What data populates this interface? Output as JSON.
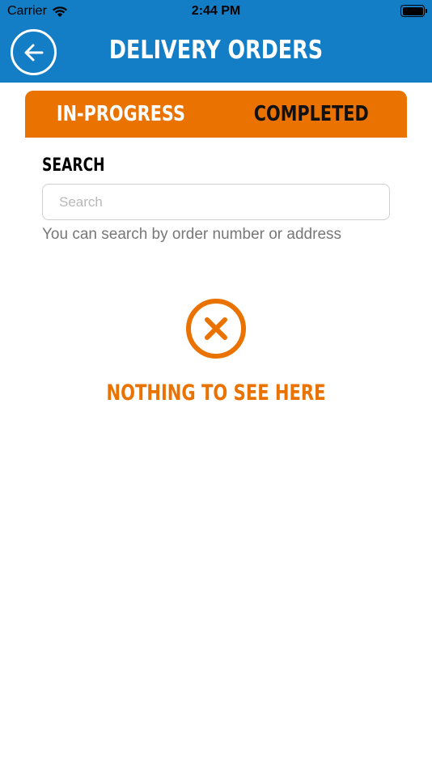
{
  "status_bar": {
    "carrier": "Carrier",
    "time": "2:44 PM"
  },
  "header": {
    "title": "DELIVERY ORDERS",
    "back_icon": "arrow-left-icon",
    "background_color": "#137dc5"
  },
  "tabs": [
    {
      "label": "IN-PROGRESS",
      "active": true
    },
    {
      "label": "COMPLETED",
      "active": false
    }
  ],
  "search": {
    "label": "SEARCH",
    "placeholder": "Search",
    "value": "",
    "hint": "You can search by order number or address"
  },
  "empty_state": {
    "icon": "close-circle-icon",
    "message": "NOTHING TO SEE HERE"
  },
  "colors": {
    "accent": "#ea7200",
    "primary": "#137dc5"
  }
}
